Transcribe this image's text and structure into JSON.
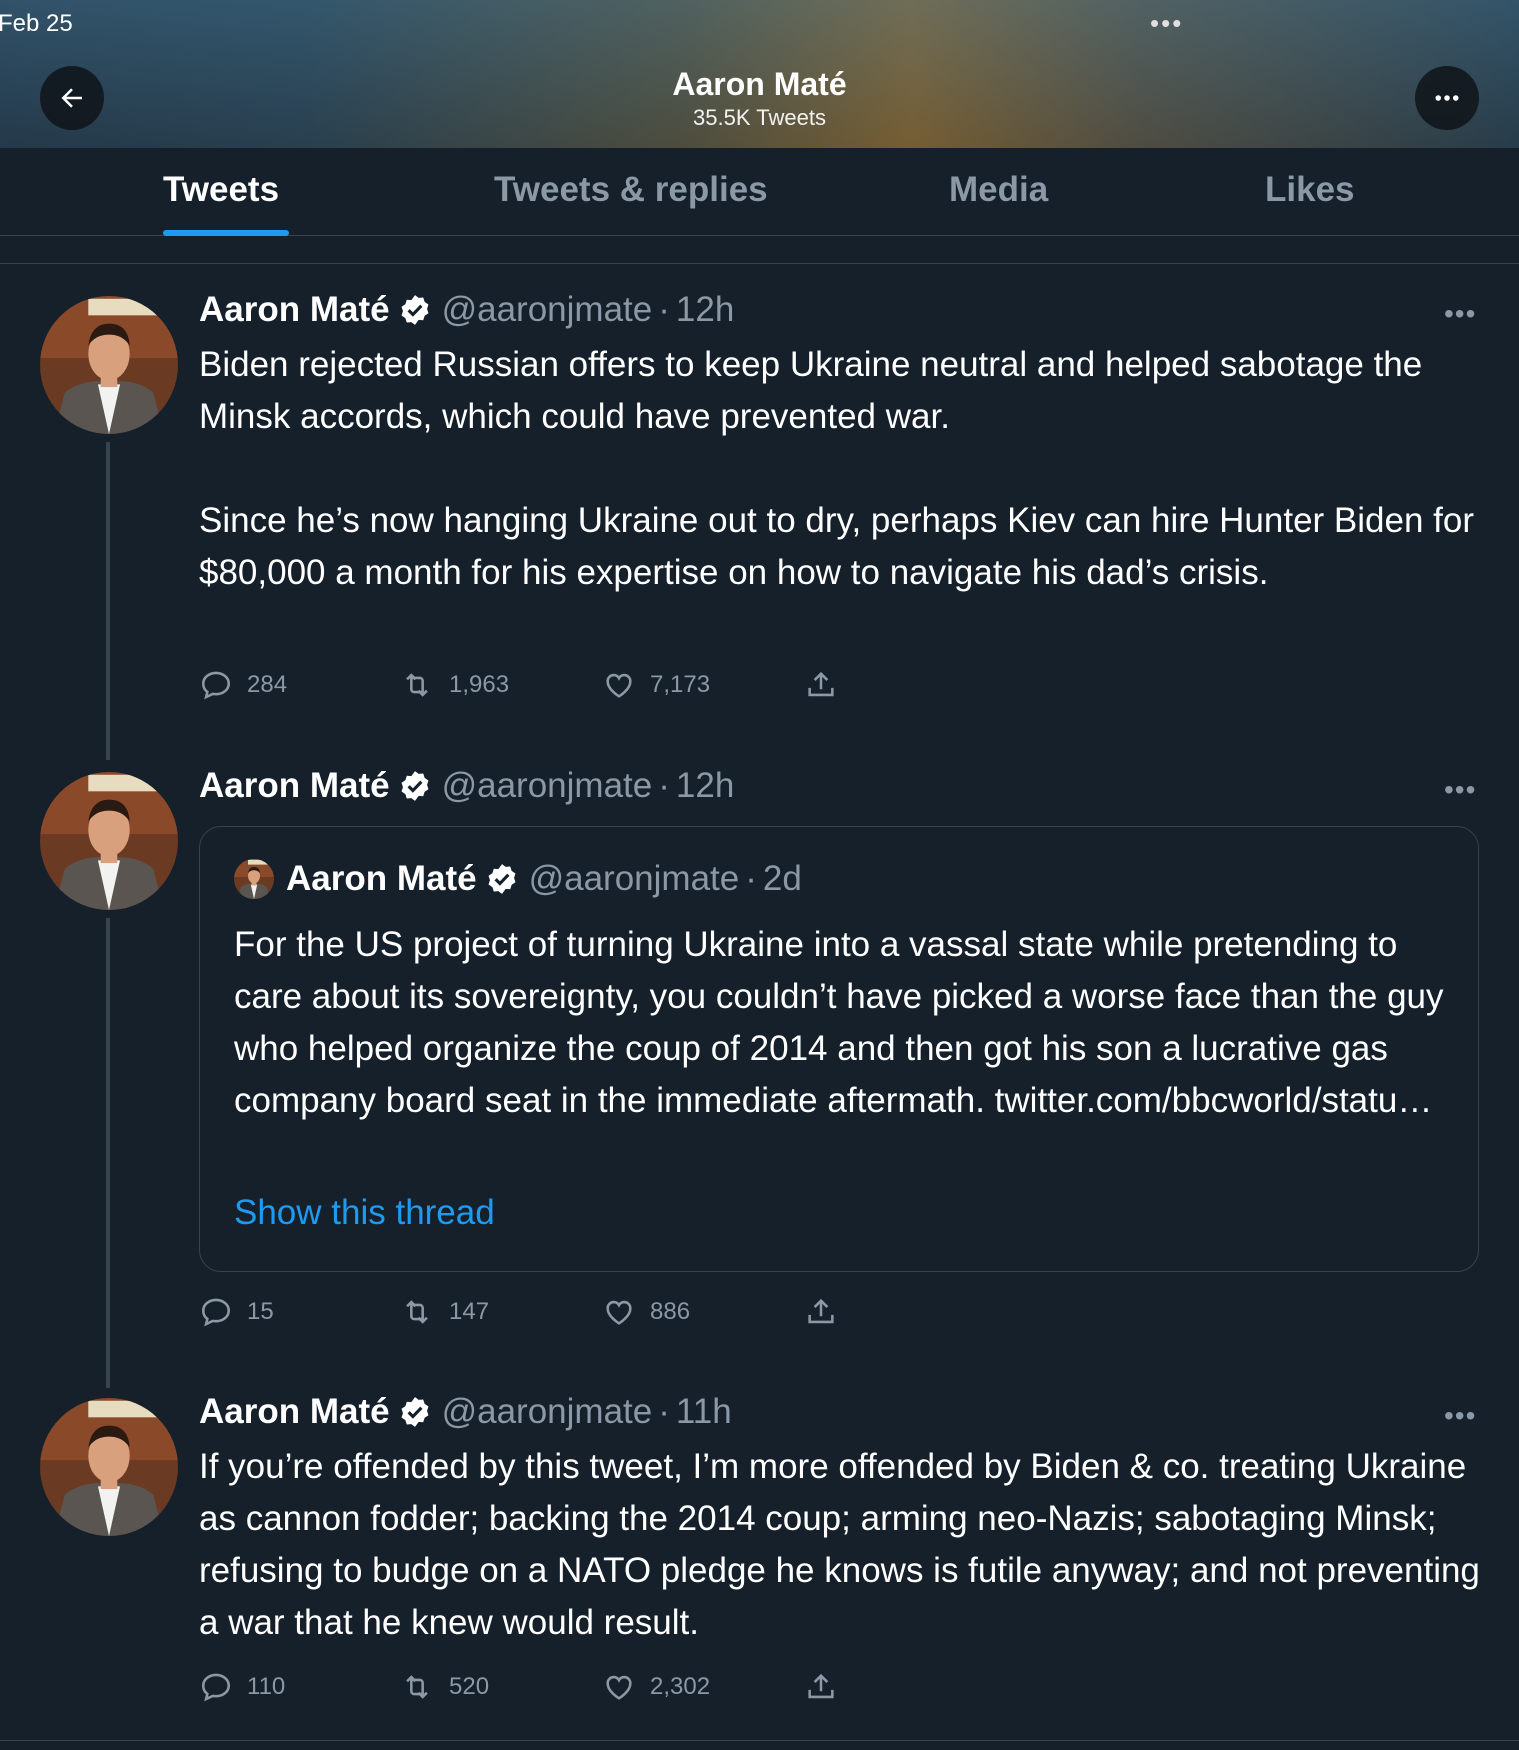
{
  "status": {
    "date": "Feb 25",
    "dots": "•••"
  },
  "header": {
    "name": "Aaron Maté",
    "tweet_count": "35.5K Tweets"
  },
  "tabs": [
    {
      "label": "Tweets",
      "active": true
    },
    {
      "label": "Tweets & replies",
      "active": false
    },
    {
      "label": "Media",
      "active": false
    },
    {
      "label": "Likes",
      "active": false
    }
  ],
  "tweets": [
    {
      "name": "Aaron Maté",
      "handle": "@aaronjmate",
      "separator": "·",
      "time": "12h",
      "text": "Biden rejected Russian offers to keep Ukraine neutral and helped sabotage the Minsk accords, which could have prevented war.\n\nSince he’s now hanging Ukraine out to dry, perhaps Kiev can hire Hunter Biden for $80,000 a month for his expertise on how to navigate his dad’s crisis.",
      "replies": "284",
      "retweets": "1,963",
      "likes": "7,173"
    },
    {
      "name": "Aaron Maté",
      "handle": "@aaronjmate",
      "separator": "·",
      "time": "12h",
      "quote": {
        "name": "Aaron Maté",
        "handle": "@aaronjmate",
        "separator": "·",
        "time": "2d",
        "text": "For the US project of turning Ukraine into a vassal state while pretending to care about its sovereignty, you couldn’t have picked a worse face than the guy who helped organize the coup of 2014 and then got his son a lucrative gas company board seat in the immediate aftermath. twitter.com/bbcworld/statu…",
        "link": "Show this thread"
      },
      "replies": "15",
      "retweets": "147",
      "likes": "886"
    },
    {
      "name": "Aaron Maté",
      "handle": "@aaronjmate",
      "separator": "·",
      "time": "11h",
      "text": "If you’re offended by this tweet, I’m more offended by Biden & co. treating Ukraine as cannon fodder; backing the 2014 coup; arming neo-Nazis; sabotaging Minsk; refusing to budge on a NATO pledge he knows is futile anyway; and not preventing a war that he knew would result.",
      "replies": "110",
      "retweets": "520",
      "likes": "2,302"
    }
  ],
  "more_glyph": "•••",
  "colors": {
    "background": "#15202b",
    "accent": "#1d9bf0",
    "muted": "#8b98a5",
    "border": "#38444d"
  }
}
